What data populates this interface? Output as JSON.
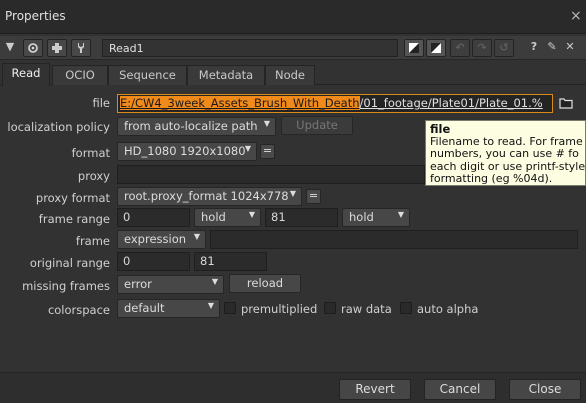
{
  "window": {
    "title": "Properties",
    "close_glyph": "×"
  },
  "nodebar": {
    "collapse_glyph": "▼",
    "node_name": "Read1",
    "help_glyph": "?",
    "float_glyph": "✎",
    "close_glyph": "✕"
  },
  "tabs": [
    "Read",
    "OCIO",
    "Sequence",
    "Metadata",
    "Node"
  ],
  "fields": {
    "file": {
      "label": "file",
      "selected": "E:/CW4_3week_Assets_Brush_With_Death",
      "rest": "/01_footage/Plate01/Plate_01.%"
    },
    "localization_policy": {
      "label": "localization policy",
      "value": "from auto-localize path",
      "button": "Update"
    },
    "format": {
      "label": "format",
      "value": "HD_1080 1920x1080",
      "eq": "="
    },
    "proxy": {
      "label": "proxy",
      "value": ""
    },
    "proxy_format": {
      "label": "proxy format",
      "value": "root.proxy_format 1024x778",
      "eq": "="
    },
    "frame_range": {
      "label": "frame range",
      "first": "0",
      "first_mode": "hold",
      "last": "81",
      "last_mode": "hold"
    },
    "frame": {
      "label": "frame",
      "mode": "expression",
      "value": ""
    },
    "original_range": {
      "label": "original range",
      "first": "0",
      "last": "81"
    },
    "missing_frames": {
      "label": "missing frames",
      "value": "error",
      "button": "reload"
    },
    "colorspace": {
      "label": "colorspace",
      "value": "default",
      "premultiplied": "premultiplied",
      "raw_data": "raw data",
      "auto_alpha": "auto alpha"
    }
  },
  "tooltip": {
    "title": "file",
    "lines": [
      "Filename to read. For frame",
      "numbers, you can use # fo",
      "each digit or use printf-style",
      "formatting (eg %04d)."
    ]
  },
  "footer": {
    "revert": "Revert",
    "cancel": "Cancel",
    "close": "Close"
  },
  "colors": {
    "background": "#323232",
    "selection_orange": "#f08a1a",
    "tooltip_bg": "#fdfde2"
  }
}
